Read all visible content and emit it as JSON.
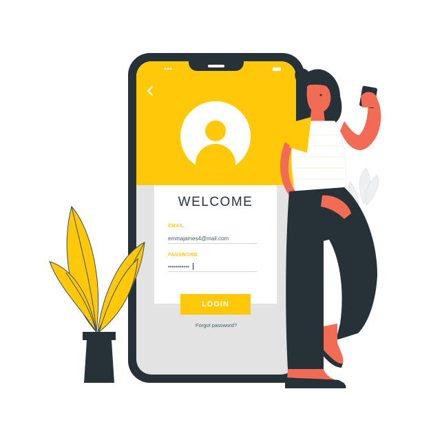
{
  "colors": {
    "accent": "#ffc90a",
    "dark": "#263238",
    "skin": "#f26b55",
    "screen_bg": "#e3e3e3"
  },
  "status_bar": {
    "icons": [
      "wifi-icon",
      "battery-icon"
    ]
  },
  "header": {
    "back_icon": "chevron-left-icon",
    "avatar_icon": "user-avatar-icon"
  },
  "login": {
    "title": "WELCOME",
    "email_label": "EMAIL",
    "email_value": "emmajames4@mail.com",
    "password_label": "PASSWORD",
    "password_value": "•••••••••••",
    "button_label": "LOGIN",
    "forgot_label": "Forgot password?"
  }
}
